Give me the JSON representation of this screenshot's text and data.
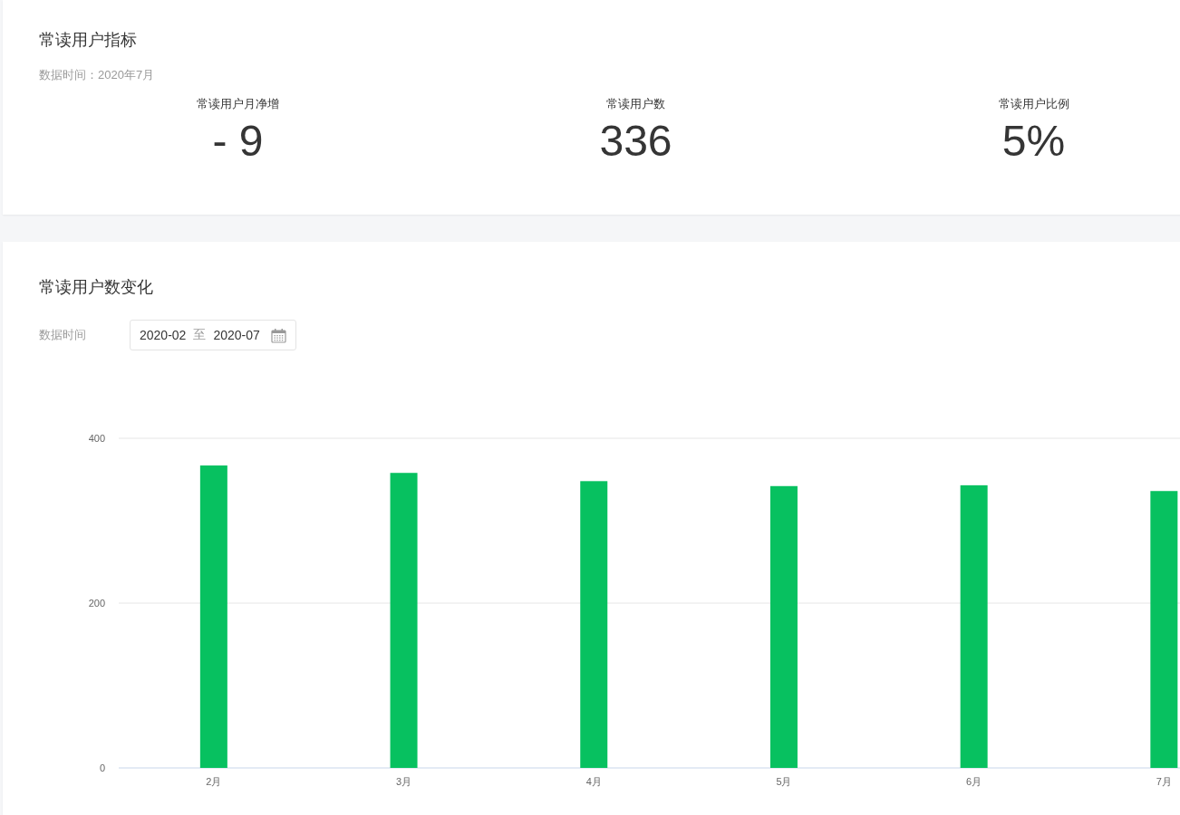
{
  "summary": {
    "title": "常读用户指标",
    "data_time": "数据时间：2020年7月",
    "metrics": [
      {
        "label": "常读用户月净增",
        "value": "- 9"
      },
      {
        "label": "常读用户数",
        "value": "336"
      },
      {
        "label": "常读用户比例",
        "value": "5%"
      }
    ]
  },
  "trend": {
    "title": "常读用户数变化",
    "filter_label": "数据时间",
    "date_range": {
      "start": "2020-02",
      "separator": "至",
      "end": "2020-07"
    },
    "chart_data": {
      "type": "bar",
      "categories": [
        "2月",
        "3月",
        "4月",
        "5月",
        "6月",
        "7月"
      ],
      "series": [
        {
          "color": "#07c160",
          "values": [
            367,
            358,
            348,
            342,
            343,
            336
          ]
        }
      ],
      "ylim": [
        0,
        400
      ],
      "yticks": [
        0,
        200,
        400
      ]
    }
  }
}
